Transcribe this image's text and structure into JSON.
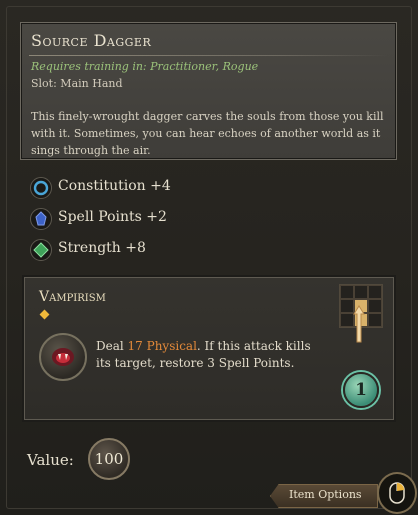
{
  "item": {
    "title": "Source Dagger",
    "requirement": "Requires training in: Practitioner, Rogue",
    "slot": "Slot: Main Hand",
    "description": "This finely-wrought dagger carves the souls from those you kill with it. Sometimes, you can hear echoes of another world as it sings through the air."
  },
  "stats": [
    {
      "label": "Constitution +4",
      "icon": "constitution-icon",
      "color": "#4aa6d8"
    },
    {
      "label": "Spell Points +2",
      "icon": "spell-points-icon",
      "color": "#3d62c7"
    },
    {
      "label": "Strength +8",
      "icon": "strength-icon",
      "color": "#3fa35a"
    }
  ],
  "ability": {
    "name": "Vampirism",
    "text_prefix": "Deal ",
    "damage": "17 Physical",
    "text_suffix": ". If this attack kills its target, restore 3 Spell Points.",
    "cost": "1",
    "icon": "vampirism-icon",
    "range_icon": "range-grid-icon"
  },
  "value": {
    "label": "Value:",
    "amount": "100"
  },
  "options_button": "Item Options",
  "colors": {
    "accent_green": "#9bc27a",
    "damage_orange": "#e48a3a",
    "cost_teal": "#6bc1a6"
  }
}
